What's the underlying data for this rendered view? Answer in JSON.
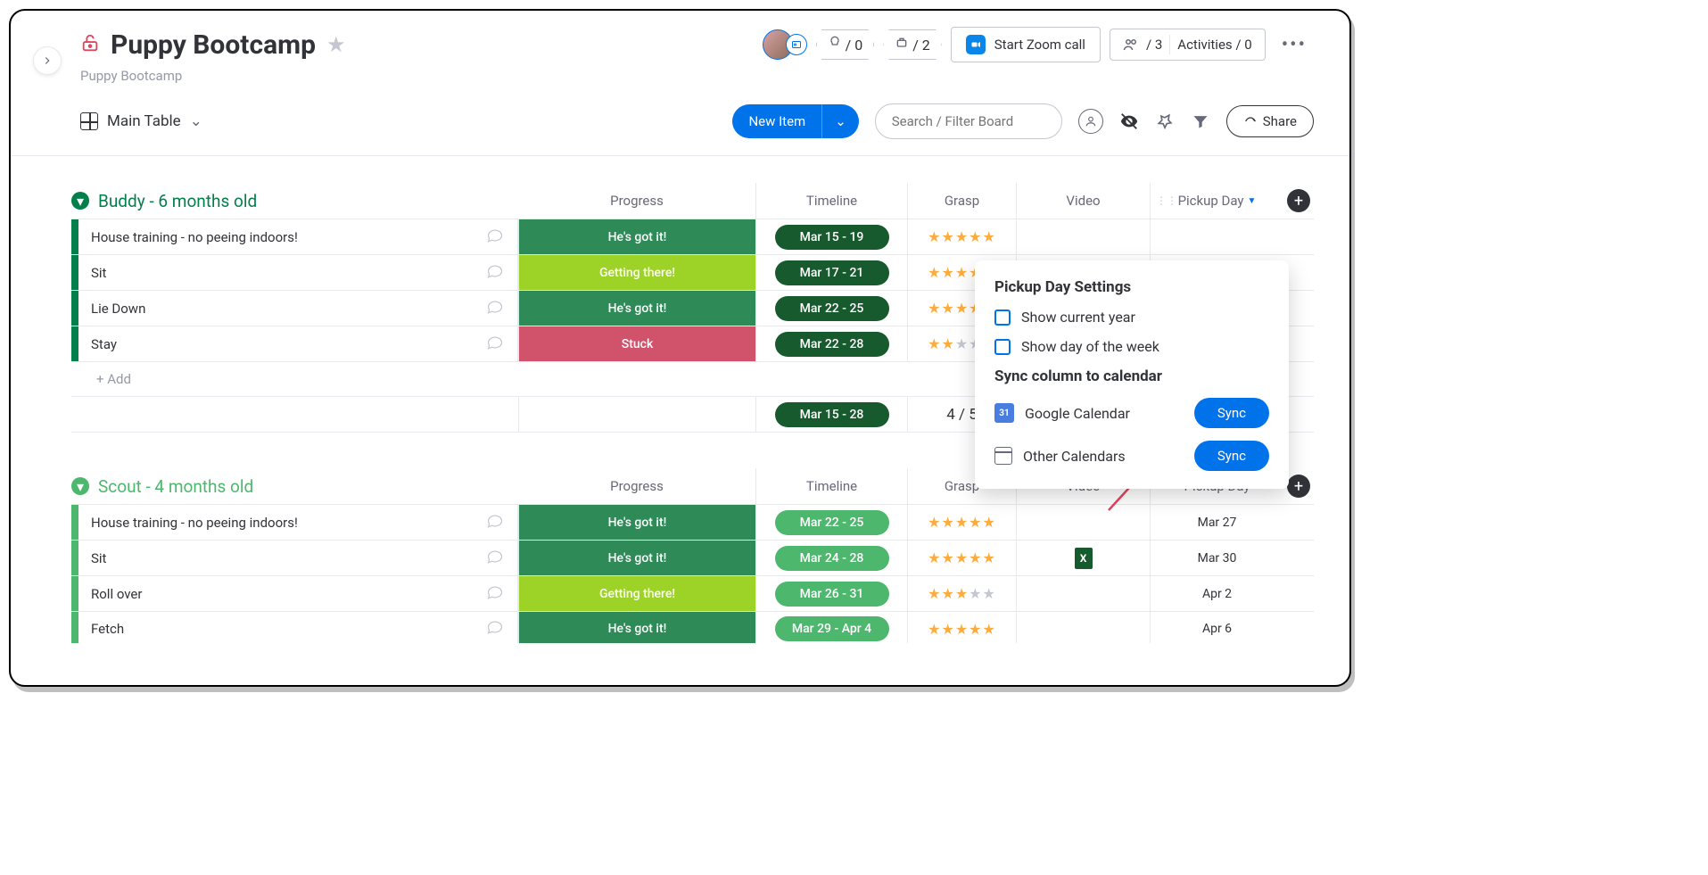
{
  "board": {
    "title": "Puppy Bootcamp",
    "breadcrumb": "Puppy Bootcamp"
  },
  "header": {
    "autopilot_count": "/ 0",
    "robot_count": "/ 2",
    "zoom_label": "Start Zoom call",
    "people_count": "/ 3",
    "activities_label": "Activities / 0"
  },
  "toolbar": {
    "view_label": "Main Table",
    "new_item_label": "New Item",
    "search_placeholder": "Search / Filter Board",
    "share_label": "Share"
  },
  "columns": {
    "progress": "Progress",
    "timeline": "Timeline",
    "grasp": "Grasp",
    "video": "Video",
    "pickup": "Pickup Day"
  },
  "groups": [
    {
      "name": "Buddy - 6 months old",
      "color": "#037f4c",
      "rows": [
        {
          "name": "House training - no peeing indoors!",
          "progress": "He's got it!",
          "pcolor": "#2e8b57",
          "timeline": "Mar 15 - 19",
          "tlight": false,
          "stars": 5,
          "video": "",
          "pickup": ""
        },
        {
          "name": "Sit",
          "progress": "Getting there!",
          "pcolor": "#9cd326",
          "timeline": "Mar 17 - 21",
          "tlight": false,
          "stars": 5,
          "video": "",
          "pickup": ""
        },
        {
          "name": "Lie Down",
          "progress": "He's got it!",
          "pcolor": "#2e8b57",
          "timeline": "Mar 22 - 25",
          "tlight": false,
          "stars": 5,
          "video": "",
          "pickup": ""
        },
        {
          "name": "Stay",
          "progress": "Stuck",
          "pcolor": "#d0536b",
          "timeline": "Mar 22 - 28",
          "tlight": false,
          "stars": 2,
          "video": "",
          "pickup": ""
        }
      ],
      "add_label": "+ Add",
      "summary": {
        "timeline": "Mar 15 - 28",
        "grasp": "4  / 5"
      }
    },
    {
      "name": "Scout - 4 months old",
      "color": "#4eb76e",
      "rows": [
        {
          "name": "House training - no peeing indoors!",
          "progress": "He's got it!",
          "pcolor": "#2e8b57",
          "timeline": "Mar 22 - 25",
          "tlight": true,
          "stars": 5,
          "video": "",
          "pickup": "Mar 27"
        },
        {
          "name": "Sit",
          "progress": "He's got it!",
          "pcolor": "#2e8b57",
          "timeline": "Mar 24 - 28",
          "tlight": true,
          "stars": 5,
          "video": "excel",
          "pickup": "Mar 30"
        },
        {
          "name": "Roll over",
          "progress": "Getting there!",
          "pcolor": "#9cd326",
          "timeline": "Mar 26 - 31",
          "tlight": true,
          "stars": 3,
          "video": "",
          "pickup": "Apr 2"
        },
        {
          "name": "Fetch",
          "progress": "He's got it!",
          "pcolor": "#2e8b57",
          "timeline": "Mar 29 - Apr 4",
          "tlight": true,
          "stars": 5,
          "video": "",
          "pickup": "Apr 6"
        }
      ]
    }
  ],
  "popover": {
    "title": "Pickup Day Settings",
    "opt1": "Show current year",
    "opt2": "Show day of the week",
    "sync_title": "Sync column to calendar",
    "gcal": "Google Calendar",
    "other": "Other Calendars",
    "sync_btn": "Sync"
  }
}
